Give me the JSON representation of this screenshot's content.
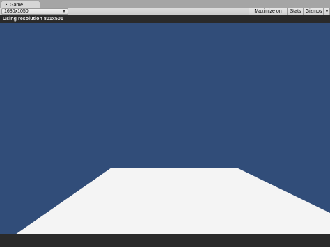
{
  "window": {
    "tab_label": "Game",
    "tab_icon": "game-controller-icon"
  },
  "toolbar": {
    "resolution_value": "1680x1050",
    "maximize_label": "Maximize on Play",
    "stats_label": "Stats",
    "gizmos_label": "Gizmos"
  },
  "status": {
    "message": "Using resolution 801x501"
  },
  "scene": {
    "sky_color": "#314d79",
    "ground_color": "#f4f4f4",
    "bottom_bar_color": "#2a2a2a"
  }
}
